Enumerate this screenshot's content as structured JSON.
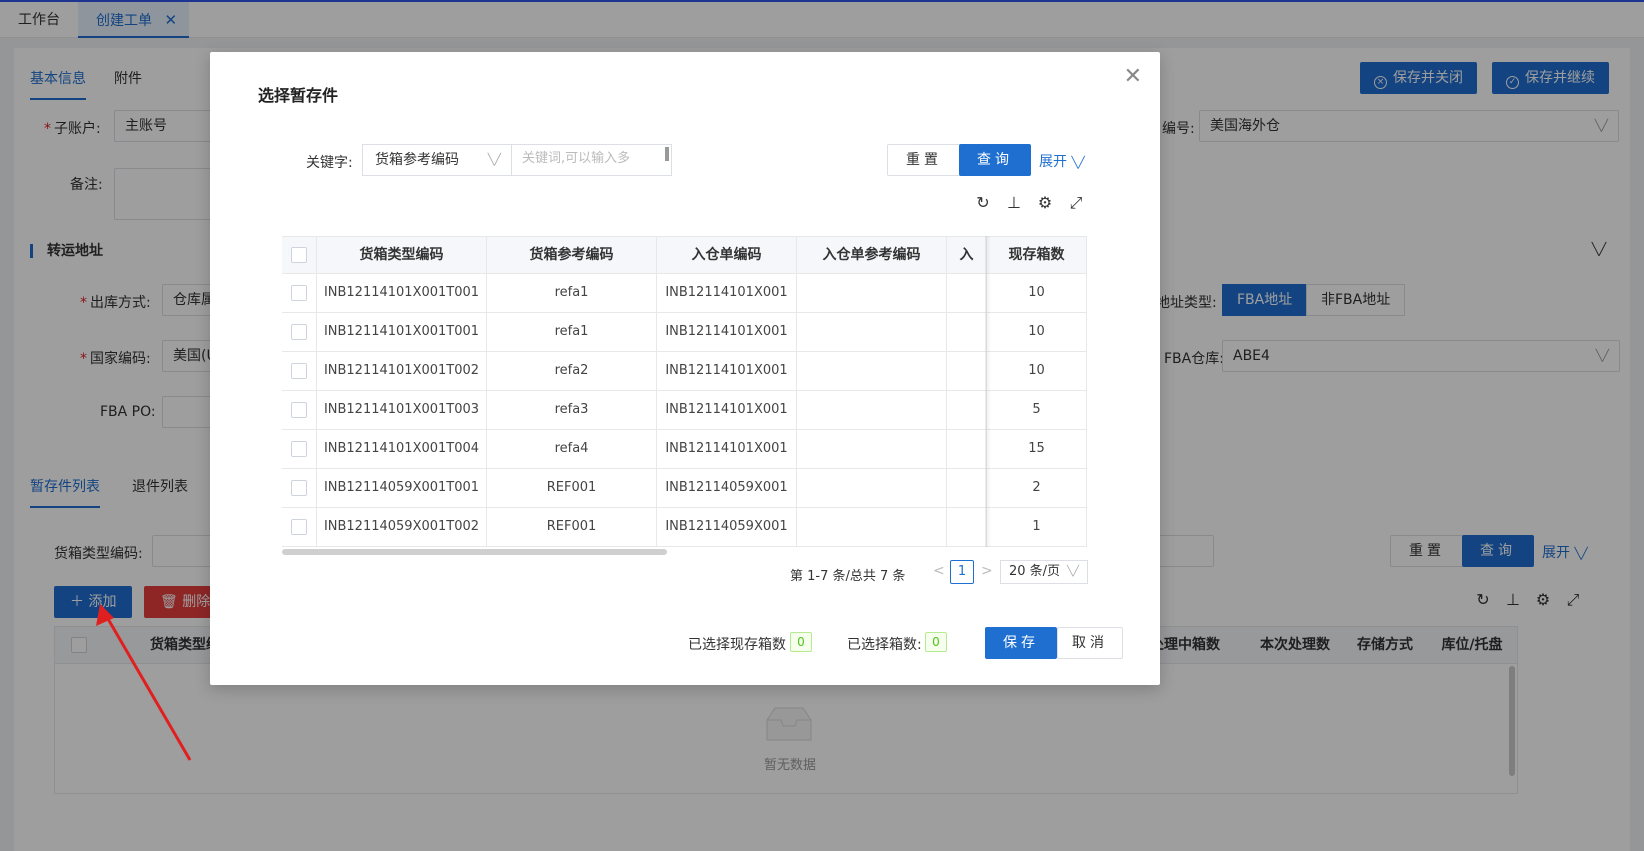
{
  "top_tabs": [
    {
      "label": "工作台"
    },
    {
      "label": "创建工单",
      "close": "✕"
    }
  ],
  "page": {
    "tabs": [
      "基本信息",
      "附件"
    ],
    "save_close_label": "保存并关闭",
    "save_continue_label": "保存并继续",
    "sub_account_label": "子账户:",
    "sub_account_value": "主账号",
    "warehouse_code_label": "编号:",
    "warehouse_code_value": "美国海外仓",
    "remark_label": "备注:",
    "transfer_section_title": "转运地址",
    "outbound_method_label": "出库方式:",
    "outbound_method_value": "仓库属",
    "address_type_label": "地址类型:",
    "address_type_options": [
      "FBA地址",
      "非FBA地址"
    ],
    "country_label": "国家编码:",
    "country_value": "美国(U",
    "fba_warehouse_label": "FBA仓库:",
    "fba_warehouse_value": "ABE4",
    "fba_po_label": "FBA PO:",
    "list_tabs": [
      "暂存件列表",
      "退件列表"
    ],
    "box_type_code_label": "货箱类型编码:",
    "reset_label": "重置",
    "query_label": "查询",
    "expand_label": "展开",
    "add_label": "添加",
    "delete_label": "删除",
    "table_headers": [
      "货箱类型编",
      "处理中箱数",
      "本次处理数",
      "存储方式",
      "库位/托盘"
    ],
    "empty_text": "暂无数据"
  },
  "modal": {
    "title": "选择暂存件",
    "keyword_label": "关键字:",
    "keyword_select_value": "货箱参考编码",
    "keyword_placeholder": "关键词,可以输入多",
    "reset_label": "重置",
    "query_label": "查询",
    "expand_label": "展开",
    "table": {
      "headers": [
        "货箱类型编码",
        "货箱参考编码",
        "入仓单编码",
        "入仓单参考编码",
        "入",
        "现存箱数"
      ],
      "rows": [
        [
          "INB12114101X001T001",
          "refa1",
          "INB12114101X001",
          "",
          "",
          "10"
        ],
        [
          "INB12114101X001T001",
          "refa1",
          "INB12114101X001",
          "",
          "",
          "10"
        ],
        [
          "INB12114101X001T002",
          "refa2",
          "INB12114101X001",
          "",
          "",
          "10"
        ],
        [
          "INB12114101X001T003",
          "refa3",
          "INB12114101X001",
          "",
          "",
          "5"
        ],
        [
          "INB12114101X001T004",
          "refa4",
          "INB12114101X001",
          "",
          "",
          "15"
        ],
        [
          "INB12114059X001T001",
          "REF001",
          "INB12114059X001",
          "",
          "",
          "2"
        ],
        [
          "INB12114059X001T002",
          "REF001",
          "INB12114059X001",
          "",
          "",
          "1"
        ]
      ]
    },
    "pager": {
      "info": "第 1-7 条/总共 7 条",
      "prev": "<",
      "current_page": "1",
      "next": ">",
      "page_size": "20 条/页"
    },
    "selected_stock_label": "已选择现存箱数",
    "selected_stock_value": "0",
    "selected_boxes_label": "已选择箱数:",
    "selected_boxes_value": "0",
    "save_label": "保存",
    "cancel_label": "取消"
  },
  "colors": {
    "primary": "#1f6fd1",
    "danger": "#e53e3e",
    "annotation_arrow": "#e02020"
  }
}
